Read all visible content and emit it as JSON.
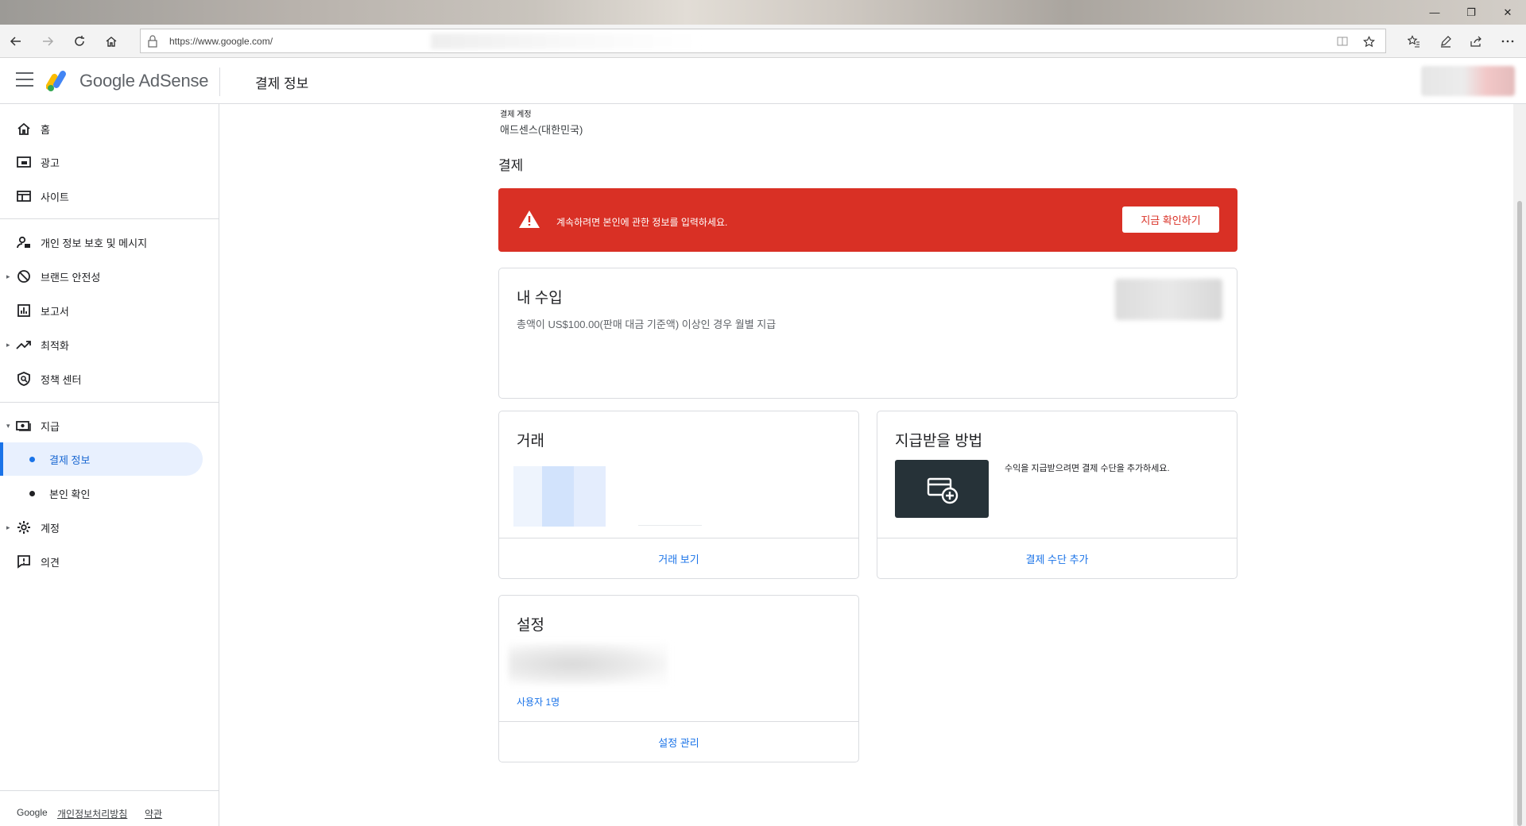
{
  "browser": {
    "url": "https://www.google.com/",
    "window_controls": {
      "minimize": "—",
      "restore": "❐",
      "close": "✕"
    }
  },
  "app": {
    "brand": "Google AdSense",
    "page_title": "결제 정보"
  },
  "sidebar": {
    "items": [
      {
        "label": "홈",
        "icon": "home-icon"
      },
      {
        "label": "광고",
        "icon": "ads-icon"
      },
      {
        "label": "사이트",
        "icon": "sites-icon"
      },
      {
        "label": "개인 정보 보호 및 메시지",
        "icon": "privacy-icon"
      },
      {
        "label": "브랜드 안전성",
        "icon": "block-icon"
      },
      {
        "label": "보고서",
        "icon": "reports-icon"
      },
      {
        "label": "최적화",
        "icon": "trending-icon"
      },
      {
        "label": "정책 센터",
        "icon": "policy-icon"
      },
      {
        "label": "지급",
        "icon": "payments-icon"
      },
      {
        "label": "계정",
        "icon": "gear-icon"
      },
      {
        "label": "의견",
        "icon": "feedback-icon"
      }
    ],
    "sub_items": [
      {
        "label": "결제 정보",
        "active": true
      },
      {
        "label": "본인 확인",
        "active": false
      }
    ],
    "footer": {
      "google": "Google",
      "privacy": "개인정보처리방침",
      "terms": "약관"
    }
  },
  "main": {
    "account_label": "결제 계정",
    "account_value": "애드센스(대한민국)",
    "section_title": "결제",
    "alert": {
      "text": "계속하려면 본인에 관한 정보를 입력하세요.",
      "button": "지금 확인하기",
      "color": "#d93025"
    },
    "earnings": {
      "title": "내 수입",
      "subtitle": "총액이 US$100.00(판매 대금 기준액) 이상인 경우 월별 지급"
    },
    "transactions": {
      "title": "거래",
      "action": "거래 보기"
    },
    "payment_method": {
      "title": "지급받을 방법",
      "text": "수익을 지급받으려면 결제 수단을 추가하세요.",
      "action": "결제 수단 추가"
    },
    "settings": {
      "title": "설정",
      "users": "사용자 1명",
      "action": "설정 관리"
    }
  },
  "colors": {
    "accent": "#1a73e8",
    "alert": "#d93025",
    "active_bg": "#e8f0fe"
  }
}
